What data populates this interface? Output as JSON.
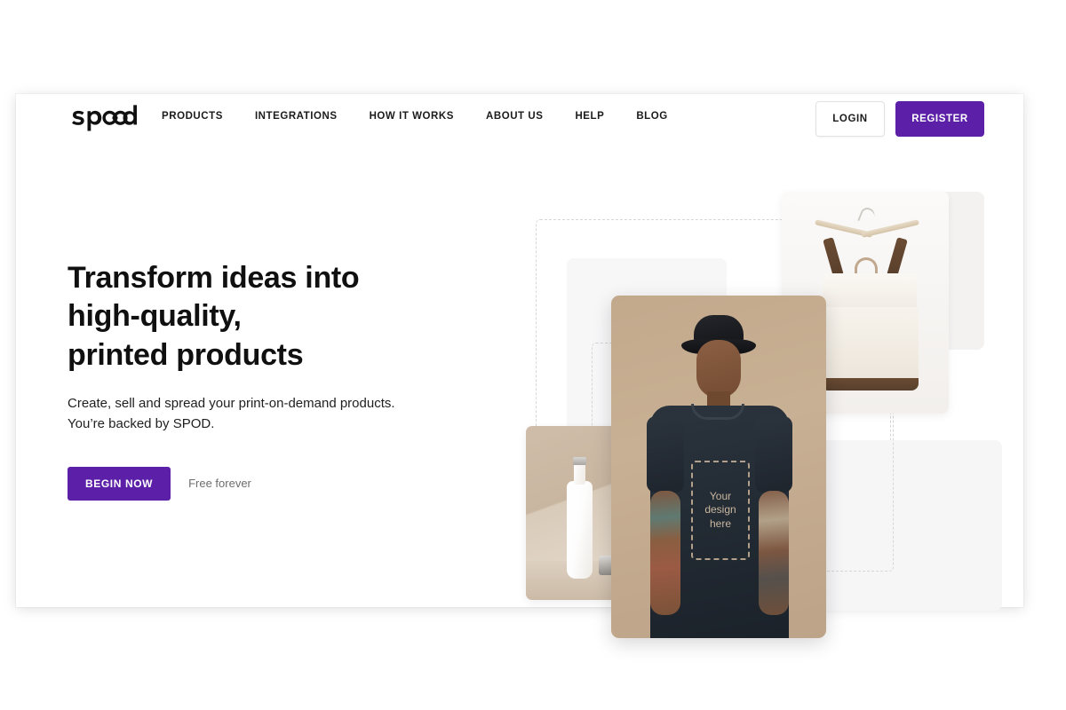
{
  "brand": {
    "logo_text": "spod"
  },
  "nav": {
    "items": [
      {
        "label": "PRODUCTS"
      },
      {
        "label": "INTEGRATIONS"
      },
      {
        "label": "HOW IT WORKS"
      },
      {
        "label": "ABOUT US"
      },
      {
        "label": "HELP"
      },
      {
        "label": "BLOG"
      }
    ]
  },
  "auth": {
    "login_label": "LOGIN",
    "register_label": "REGISTER"
  },
  "hero": {
    "headline_line1": "Transform ideas into",
    "headline_line2": "high-quality,",
    "headline_line3": "printed products",
    "subtitle": "Create, sell and spread your print-on-demand products. You’re backed by SPOD.",
    "cta_label": "BEGIN NOW",
    "cta_note": "Free forever"
  },
  "collage": {
    "design_line1": "Your",
    "design_line2": "design",
    "design_line3": "here"
  },
  "colors": {
    "brand_purple": "#5B1FA8",
    "text_dark": "#101010",
    "muted_gray": "#6d6d6d",
    "dashed_border": "#d6d6d6"
  }
}
